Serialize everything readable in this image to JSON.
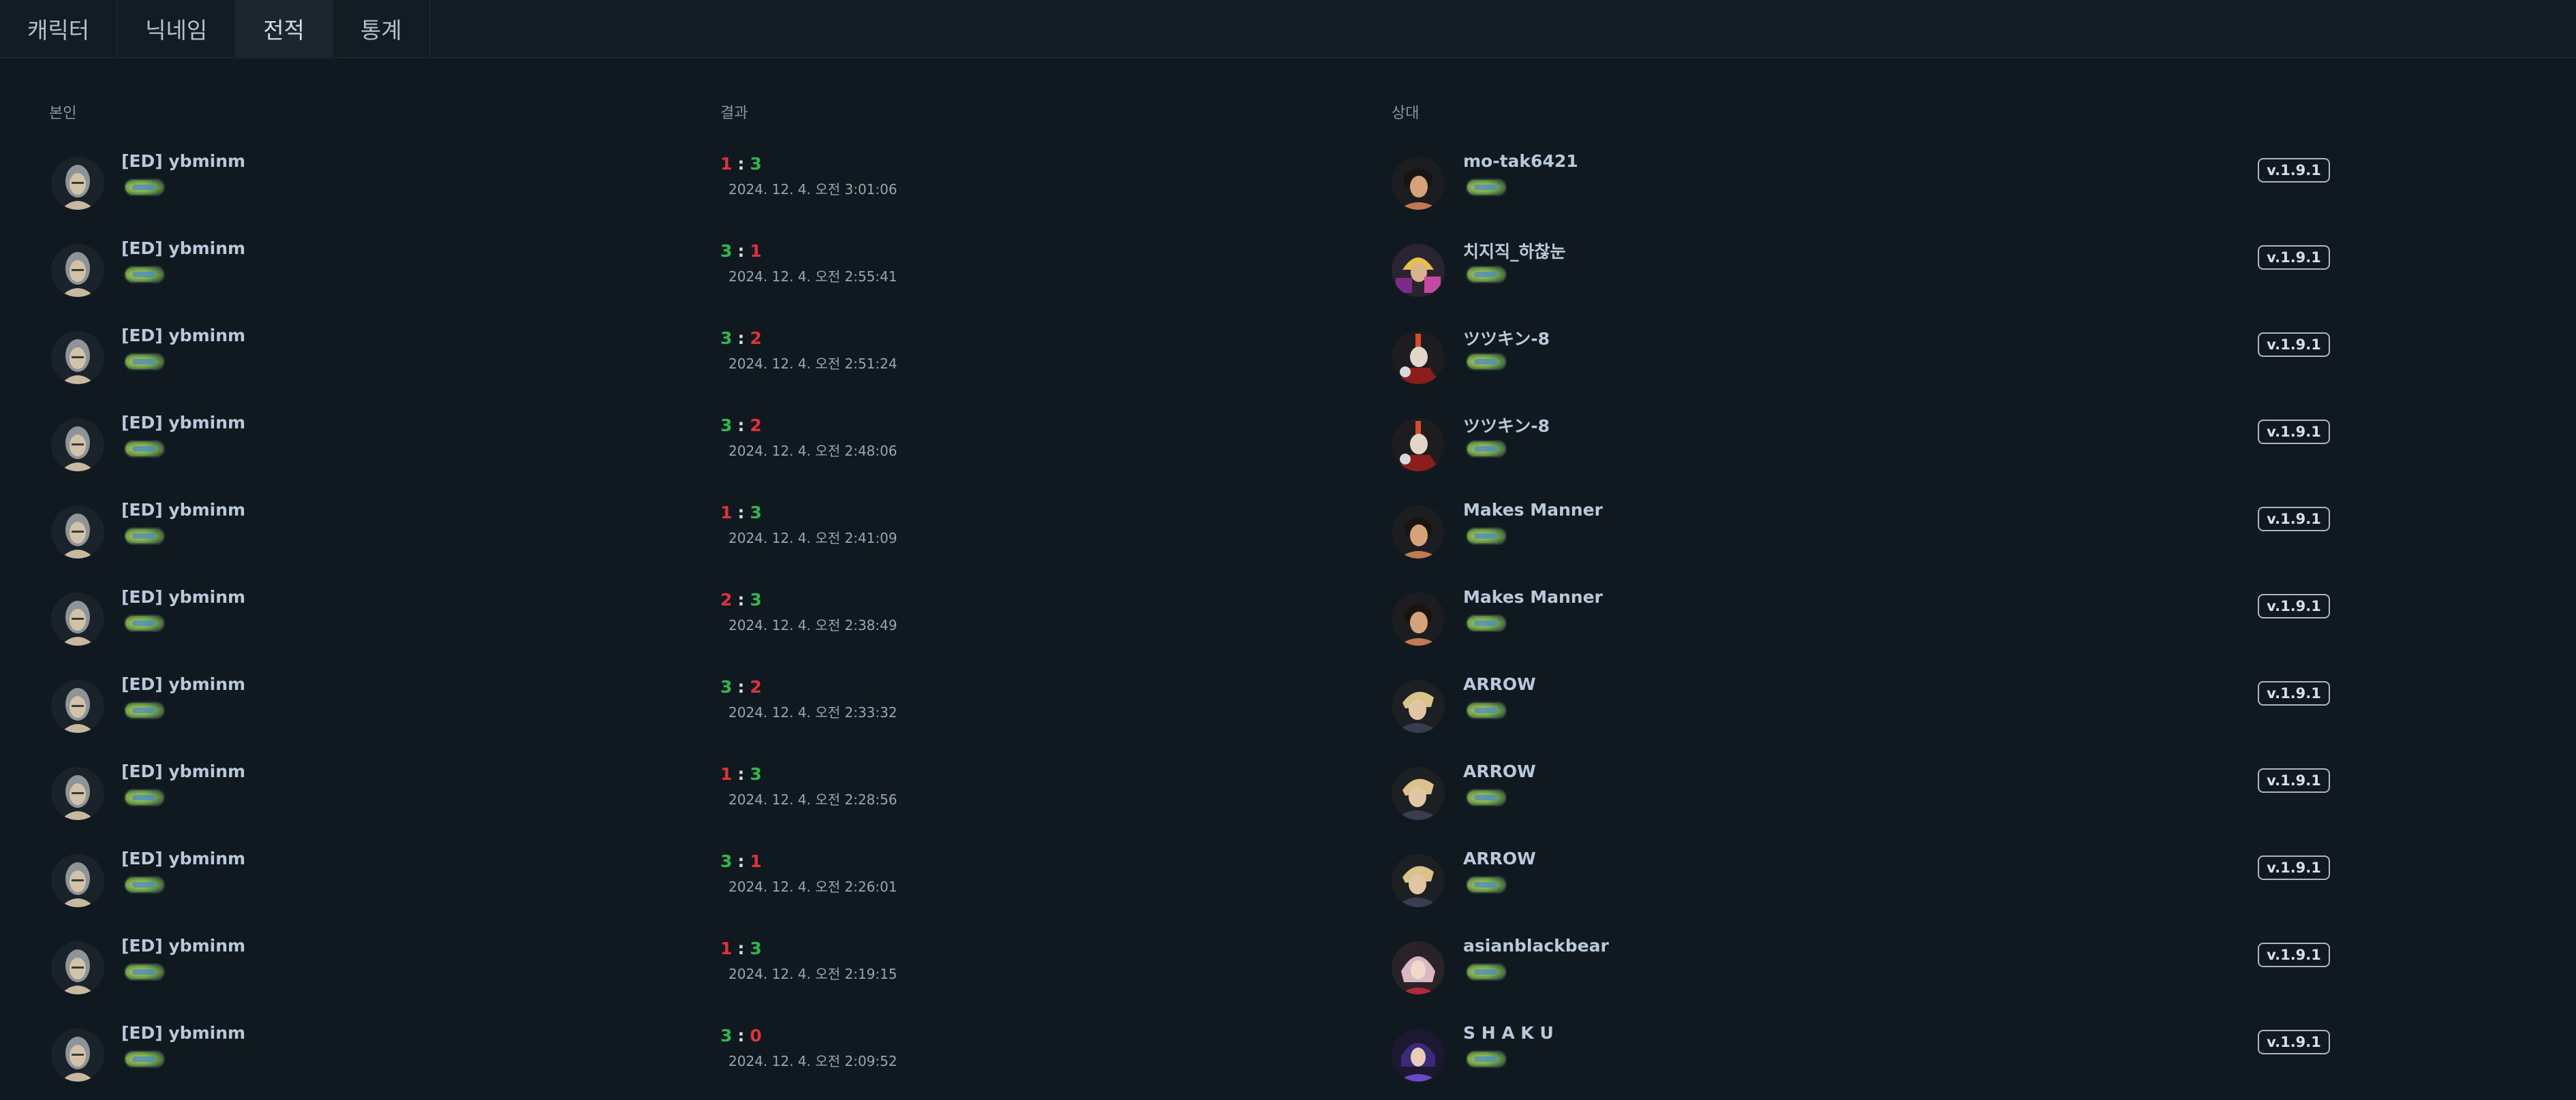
{
  "tabs": [
    {
      "label": "캐릭터",
      "active": false
    },
    {
      "label": "닉네임",
      "active": false
    },
    {
      "label": "전적",
      "active": true
    },
    {
      "label": "통계",
      "active": false
    }
  ],
  "columns": {
    "self": "본인",
    "result": "결과",
    "opponent": "상대"
  },
  "colors": {
    "win": "#2fb84b",
    "loss": "#e0323b",
    "background": "#10191f"
  },
  "matches": [
    {
      "self_name": "[ED] ybminm",
      "self_score": "1",
      "opp_score": "3",
      "date": "2024. 12. 4. 오전 3:01:06",
      "opponent": "mo-tak6421",
      "opp_character": "black-hair-fighter-icon",
      "version": "v.1.9.1"
    },
    {
      "self_name": "[ED] ybminm",
      "self_score": "3",
      "opp_score": "1",
      "date": "2024. 12. 4. 오전 2:55:41",
      "opponent": "치지직_하찮눈",
      "opp_character": "blonde-armored-fighter-icon",
      "version": "v.1.9.1"
    },
    {
      "self_name": "[ED] ybminm",
      "self_score": "3",
      "opp_score": "2",
      "date": "2024. 12. 4. 오전 2:51:24",
      "opponent": "ツツキン-8",
      "opp_character": "red-mohawk-fighter-icon",
      "version": "v.1.9.1"
    },
    {
      "self_name": "[ED] ybminm",
      "self_score": "3",
      "opp_score": "2",
      "date": "2024. 12. 4. 오전 2:48:06",
      "opponent": "ツツキン-8",
      "opp_character": "red-mohawk-fighter-icon",
      "version": "v.1.9.1"
    },
    {
      "self_name": "[ED] ybminm",
      "self_score": "1",
      "opp_score": "3",
      "date": "2024. 12. 4. 오전 2:41:09",
      "opponent": "Makes Manner",
      "opp_character": "black-hair-fighter-icon",
      "version": "v.1.9.1"
    },
    {
      "self_name": "[ED] ybminm",
      "self_score": "2",
      "opp_score": "3",
      "date": "2024. 12. 4. 오전 2:38:49",
      "opponent": "Makes Manner",
      "opp_character": "black-hair-fighter-icon",
      "version": "v.1.9.1"
    },
    {
      "self_name": "[ED] ybminm",
      "self_score": "3",
      "opp_score": "2",
      "date": "2024. 12. 4. 오전 2:33:32",
      "opponent": "ARROW",
      "opp_character": "blond-boxer-icon",
      "version": "v.1.9.1"
    },
    {
      "self_name": "[ED] ybminm",
      "self_score": "1",
      "opp_score": "3",
      "date": "2024. 12. 4. 오전 2:28:56",
      "opponent": "ARROW",
      "opp_character": "blond-boxer-icon",
      "version": "v.1.9.1"
    },
    {
      "self_name": "[ED] ybminm",
      "self_score": "3",
      "opp_score": "1",
      "date": "2024. 12. 4. 오전 2:26:01",
      "opponent": "ARROW",
      "opp_character": "blond-boxer-icon",
      "version": "v.1.9.1"
    },
    {
      "self_name": "[ED] ybminm",
      "self_score": "1",
      "opp_score": "3",
      "date": "2024. 12. 4. 오전 2:19:15",
      "opponent": "asianblackbear",
      "opp_character": "pink-hair-fighter-icon",
      "version": "v.1.9.1"
    },
    {
      "self_name": "[ED] ybminm",
      "self_score": "3",
      "opp_score": "0",
      "date": "2024. 12. 4. 오전 2:09:52",
      "opponent": "S H A K U",
      "opp_character": "purple-hair-fighter-icon",
      "version": "v.1.9.1"
    }
  ]
}
